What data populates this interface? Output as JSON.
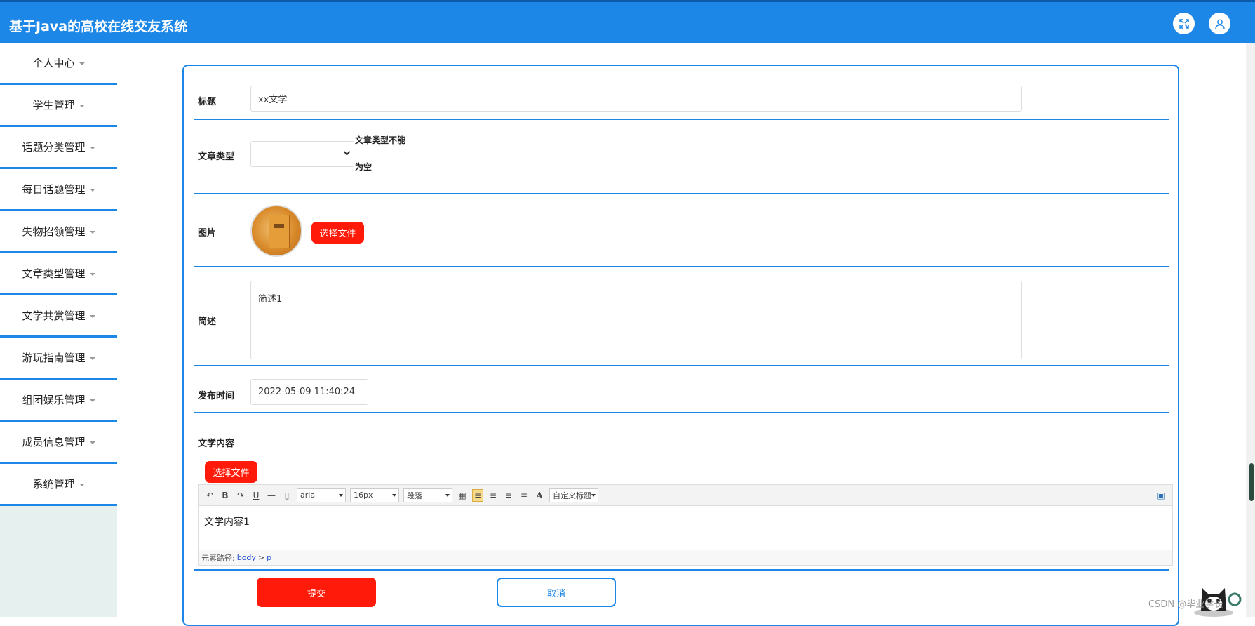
{
  "app": {
    "title": "基于Java的高校在线交友系统"
  },
  "header": {
    "expand_icon": "expand-icon",
    "user_icon": "user-icon"
  },
  "sidebar": {
    "items": [
      {
        "label": "个人中心"
      },
      {
        "label": "学生管理"
      },
      {
        "label": "话题分类管理"
      },
      {
        "label": "每日话题管理"
      },
      {
        "label": "失物招领管理"
      },
      {
        "label": "文章类型管理"
      },
      {
        "label": "文学共赏管理"
      },
      {
        "label": "游玩指南管理"
      },
      {
        "label": "组团娱乐管理"
      },
      {
        "label": "成员信息管理"
      },
      {
        "label": "系统管理"
      }
    ]
  },
  "form": {
    "title_label": "标题",
    "title_value": "xx文学",
    "type_label": "文章类型",
    "type_value": "",
    "type_error": "文章类型不能为空",
    "image_label": "图片",
    "choose_file": "选择文件",
    "summary_label": "简述",
    "summary_value": "简述1",
    "publish_label": "发布时间",
    "publish_value": "2022-05-09 11:40:24",
    "content_label": "文学内容",
    "content_choose_file": "选择文件",
    "editor": {
      "font_family": "arial",
      "font_size": "16px",
      "paragraph": "段落",
      "custom_title": "自定义标题",
      "body_text": "文学内容1",
      "path_label": "元素路径:",
      "path_body": "body",
      "path_sep": ">",
      "path_p": "p",
      "bold": "B",
      "underline": "U",
      "font_color": "A"
    },
    "submit_label": "提交",
    "cancel_label": "取消"
  },
  "watermark": "CSDN @毕业学长"
}
